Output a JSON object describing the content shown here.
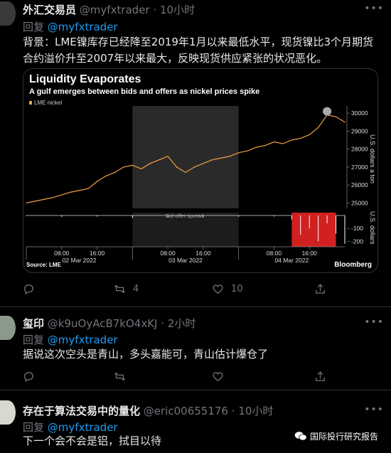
{
  "tweets": [
    {
      "name": "外汇交易员",
      "handle": "@myfxtrader",
      "separator": "·",
      "time": "10小时",
      "reply_prefix": "回复",
      "reply_to": "@myfxtrader",
      "text": "背景：LME镍库存已经降至2019年1月以来最低水平，现货镍比3个月期货合约溢价升至2007年以来最大，反映现货供应紧张的状况恶化。",
      "retweets": "4",
      "likes": "10"
    },
    {
      "name": "玺印",
      "handle": "@k9uOyAcB7kO4xKJ",
      "separator": "·",
      "time": "2小时",
      "reply_prefix": "回复",
      "reply_to": "@myfxtrader",
      "text": "据说这次空头是青山，多头嘉能可，青山估计爆仓了"
    },
    {
      "name": "存在于算法交易中的量化",
      "handle": "@eric00655176",
      "separator": "·",
      "time": "10小时",
      "reply_prefix": "回复",
      "reply_to": "@myfxtrader",
      "text": "下一个会不会是铝，拭目以待"
    }
  ],
  "icons": {
    "reply": "comment-icon",
    "retweet": "retweet-icon",
    "like": "heart-icon",
    "share": "share-icon",
    "more": "more-icon"
  },
  "colors": {
    "background": "#000000",
    "link": "#1d9bf0",
    "muted": "#71767b",
    "series": "#f0a040",
    "spread": "#d02020"
  },
  "watermark": "国际投行研究报告",
  "chart_data": {
    "type": "line",
    "title": "Liquidity Evaporates",
    "subtitle": "A gulf emerges between bids and offers as nickel prices spike",
    "legend": "LME nickel",
    "sub_panel_label": "Bid-offer spread",
    "ylabel": "U.S. dollars a ton",
    "ylabel2": "U.S. dollars",
    "source": "Source: LME",
    "brand": "Bloomberg",
    "yticks": [
      "30000",
      "29000",
      "28000",
      "27000",
      "26000",
      "25000"
    ],
    "yticks2": [
      "-100",
      "-200"
    ],
    "xticks": [
      "08:00",
      "16:00",
      "08:00",
      "16:00",
      "08:00",
      "16:00"
    ],
    "xdates": [
      "02 Mar 2022",
      "03 Mar 2022",
      "04 Mar 2022"
    ],
    "ylim": [
      24700,
      30400
    ],
    "series": [
      {
        "name": "LME nickel",
        "x": [
          0,
          2,
          4,
          6,
          8,
          10,
          12,
          14,
          16,
          18,
          20,
          22,
          24,
          26,
          28,
          30,
          32,
          34,
          36,
          38,
          40,
          42,
          44,
          46,
          48,
          50,
          52,
          54,
          56,
          58,
          60,
          62,
          64,
          66,
          68,
          70,
          72
        ],
        "values": [
          25000,
          25100,
          25200,
          25300,
          25450,
          25600,
          25700,
          25800,
          26200,
          26500,
          26700,
          27000,
          27100,
          26900,
          27200,
          27400,
          27600,
          27000,
          26700,
          27000,
          27200,
          27400,
          27500,
          27600,
          27800,
          27900,
          28100,
          28200,
          28400,
          28300,
          28500,
          28600,
          28800,
          29200,
          29900,
          29800,
          29500
        ]
      }
    ],
    "peak_marker": {
      "x": 68,
      "y": 30100
    },
    "spread": {
      "x": [
        0,
        8,
        16,
        24,
        32,
        40,
        48,
        56,
        60,
        62,
        64,
        66,
        68,
        70,
        72
      ],
      "values": [
        -5,
        -10,
        -8,
        -20,
        -15,
        -12,
        -10,
        -8,
        -30,
        -150,
        -100,
        -200,
        -60,
        -140,
        -220
      ]
    },
    "shaded_region": {
      "x_start": 24,
      "x_end": 48
    }
  }
}
